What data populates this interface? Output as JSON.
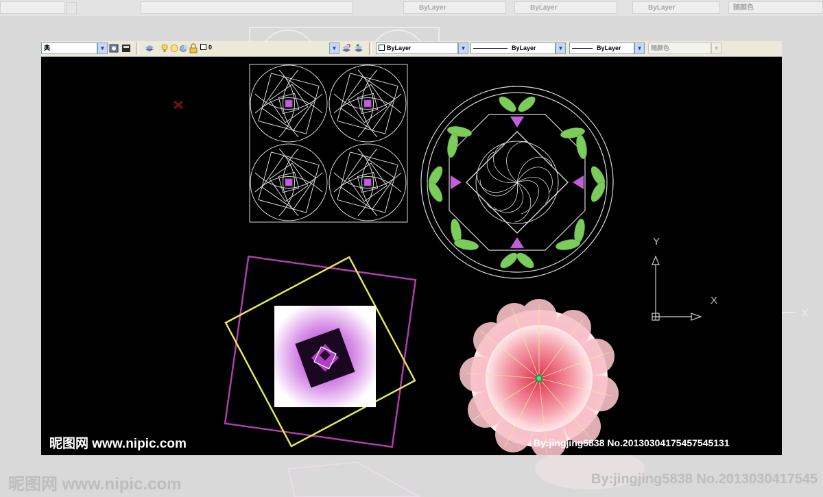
{
  "window": {
    "background_color": "#000000"
  },
  "toolbar": {
    "style_value": "典",
    "layer_value": "0",
    "color_value": "ByLayer",
    "linetype_value": "ByLayer",
    "lineweight_value": "ByLayer",
    "plotstyle_value": "随颜色"
  },
  "icons": [
    "dropdown-arrow-icon",
    "layer-manager-icon",
    "layer-state-icon",
    "layers-stack-icon",
    "lightbulb-icon",
    "sun-icon",
    "lock-icon",
    "color-swatch-icon",
    "make-layer-current-icon",
    "layer-previous-icon"
  ],
  "ucs": {
    "y_label": "Y",
    "x_label": "X"
  },
  "watermark": {
    "site": "昵图网 www.nipic.com",
    "credit": "By:jingjing5838  No.20130304175457545131"
  },
  "background": {
    "credit": "By:jingjing5838  No.2013030417545"
  },
  "colors": {
    "magenta": "#b03cb0",
    "yellow": "#e6e65a",
    "green": "#7ccc5c",
    "violet": "#c060d8",
    "pink": "#f07080"
  }
}
